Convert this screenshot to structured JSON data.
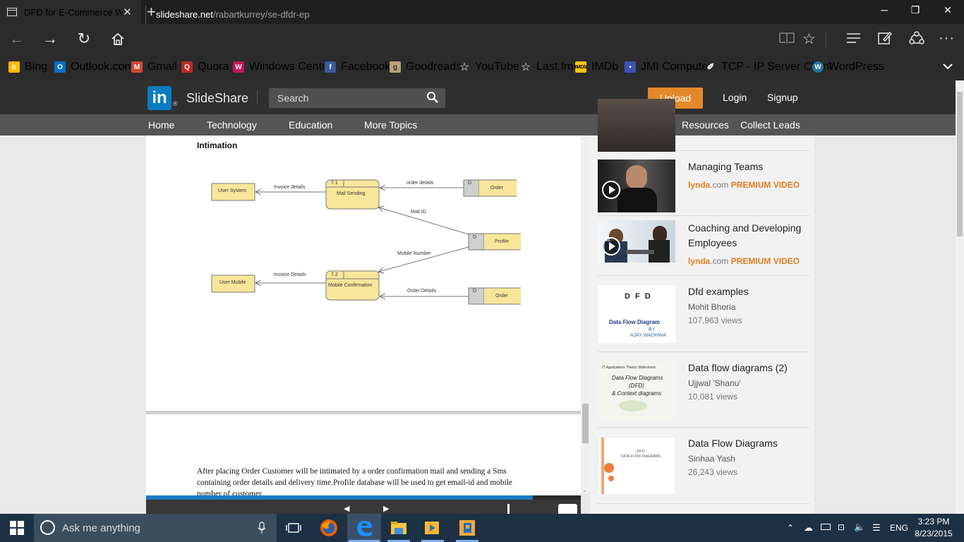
{
  "browser": {
    "tab_title": "DFD for E-Commerce W",
    "url_domain": "slideshare.net",
    "url_path": "/rabartkurrey/se-dfdr-ep",
    "favorites": [
      {
        "label": "Bing",
        "icon": "bing-icon",
        "color": "#ffb900"
      },
      {
        "label": "Outlook.com",
        "icon": "outlook-icon",
        "color": "#0072c6"
      },
      {
        "label": "Gmail",
        "icon": "gmail-icon",
        "color": "#d14836"
      },
      {
        "label": "Quora",
        "icon": "quora-icon",
        "color": "#b92b27"
      },
      {
        "label": "Windows Central",
        "icon": "windows-central-icon",
        "color": "#c2185b"
      },
      {
        "label": "Facebook",
        "icon": "facebook-icon",
        "color": "#3b5998"
      },
      {
        "label": "Goodreads",
        "icon": "goodreads-icon",
        "color": "#b7a27a"
      },
      {
        "label": "YouTube",
        "icon": "star-icon",
        "color": "#2b2b2b"
      },
      {
        "label": "Last.fm",
        "icon": "star-icon",
        "color": "#2b2b2b"
      },
      {
        "label": "IMDb",
        "icon": "imdb-icon",
        "color": "#f5c518"
      },
      {
        "label": "JMI Computer",
        "icon": "jmi-icon",
        "color": "#3f51b5"
      },
      {
        "label": "TCP - IP Server Client",
        "icon": "tcp-icon",
        "color": "#2b2b2b"
      },
      {
        "label": "WordPress",
        "icon": "wordpress-icon",
        "color": "#21759b"
      }
    ]
  },
  "slideshare": {
    "logo_text": "SlideShare",
    "logo_badge": "in",
    "search_placeholder": "Search",
    "upload_label": "Upload",
    "login_label": "Login",
    "signup_label": "Signup",
    "nav_left": [
      "Home",
      "Technology",
      "Education",
      "More Topics"
    ],
    "nav_right": [
      "Resources",
      "Collect Leads"
    ]
  },
  "slide": {
    "heading": "Intimation",
    "diagram": {
      "processes": [
        {
          "id": "7.1",
          "label": "Mail Sending"
        },
        {
          "id": "7.2",
          "label": "Mobile Confirmation"
        }
      ],
      "entities": [
        "User System",
        "User Mobile"
      ],
      "stores": [
        {
          "marker": "D",
          "label": "Order"
        },
        {
          "marker": "D",
          "label": "Profile"
        },
        {
          "marker": "D",
          "label": "Order"
        }
      ],
      "flows": [
        "Invoice details",
        "order details",
        "Mail ID",
        "Mobile Number",
        "Invoice Details",
        "Order Details"
      ]
    },
    "next_text": "After placing Order Customer will be intimated  by a order confirmation mail and sending a Sms containing order details and  delivery time.Profile database will be used to get email-id and mobile number of customer.",
    "progress": 0.89
  },
  "related": [
    {
      "title": "Managing Teams",
      "brand": "lynda",
      "brand_suffix": ".com",
      "tag": "PREMIUM VIDEO"
    },
    {
      "title": "Coaching and Developing Employees",
      "brand": "lynda",
      "brand_suffix": ".com",
      "tag": "PREMIUM VIDEO"
    },
    {
      "title": "Dfd examples",
      "author": "Mohit Bhoria",
      "views": "107,963 views",
      "thumb_title": "D F D",
      "thumb_sub": "Data Flow Diagram",
      "thumb_by": "BY",
      "thumb_author": "AJAY WADHWA"
    },
    {
      "title": "Data flow diagrams (2)",
      "author": "Ujjwal 'Shanu'",
      "views": "10,081 views",
      "thumb_top": "IT Applications Theory Slideshows",
      "thumb_l1": "Data Flow Diagrams",
      "thumb_l2": "(DFD)",
      "thumb_l3": "& Context diagrams"
    },
    {
      "title": "Data Flow Diagrams",
      "author": "Sinhaa Yash",
      "views": "26,243 views",
      "thumb_l1": "::DFD::",
      "thumb_l2": "DATA FLOW DIAGRAMS"
    }
  ],
  "taskbar": {
    "search_placeholder": "Ask me anything",
    "language": "ENG",
    "time": "3:23 PM",
    "date": "8/23/2015"
  }
}
